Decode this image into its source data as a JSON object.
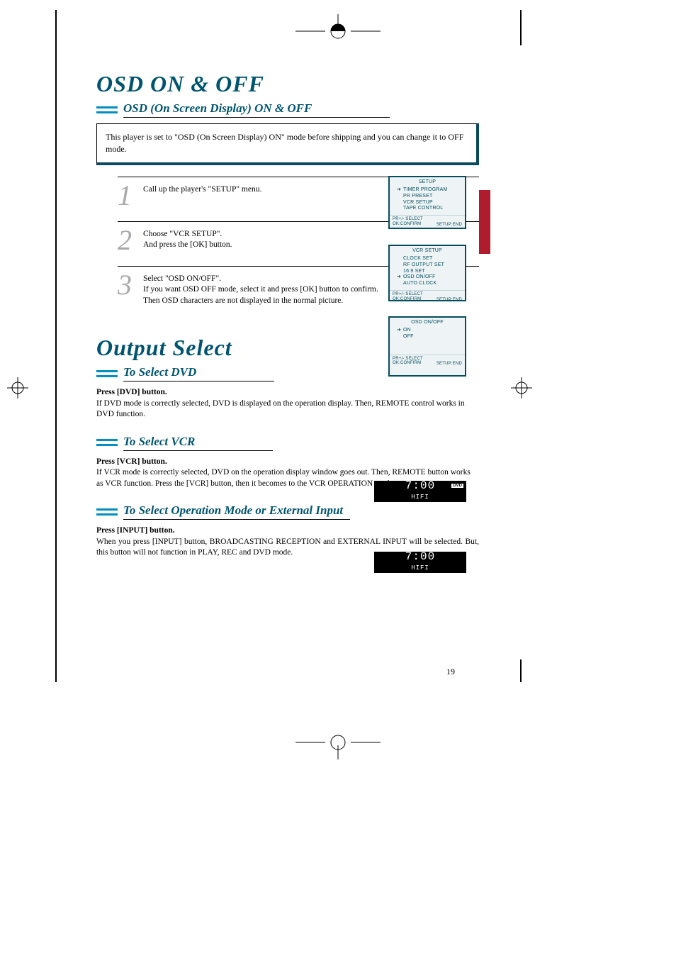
{
  "page_number": "19",
  "headings": {
    "main1": "OSD ON & OFF",
    "sub1": "OSD (On Screen Display) ON & OFF",
    "main2": "Output Select",
    "sub2": "To Select DVD",
    "sub3": "To Select VCR",
    "sub4": "To Select Operation Mode or External Input"
  },
  "intro": "This player is set to \"OSD (On Screen Display) ON\" mode before shipping and you can change it to OFF mode.",
  "steps": {
    "s1": {
      "num": "1",
      "text": "Call up the player's \"SETUP\" menu."
    },
    "s2": {
      "num": "2",
      "text": "Choose \"VCR SETUP\".\nAnd press the [OK] button."
    },
    "s3": {
      "num": "3",
      "text": "Select \"OSD ON/OFF\".\nIf you want OSD OFF mode, select it and press [OK] button to confirm.\nThen OSD characters are not displayed in the normal picture."
    }
  },
  "select_dvd": {
    "bold": "Press [DVD] button.",
    "body": "If DVD mode is correctly selected, DVD is displayed on the operation display. Then, REMOTE control works in DVD function."
  },
  "select_vcr": {
    "bold": "Press [VCR] button.",
    "body": "If VCR mode is correctly selected, DVD on the operation display window goes out. Then, REMOTE button works as VCR function. Press the [VCR] button, then it becomes to the VCR OPERATION mode."
  },
  "select_input": {
    "bold": "Press [INPUT] button.",
    "body": "When you press [INPUT] button, BROADCASTING RECEPTION and EXTERNAL INPUT will be selected. But, this button will not function in PLAY, REC and DVD mode."
  },
  "osd_panels": {
    "p1": {
      "title": "SETUP",
      "items": [
        "TIMER PROGRAM",
        "PR PRESET",
        "VCR SETUP",
        "TAPE CONTROL"
      ],
      "selected_index": 0,
      "footer_left1": "PR+/-:SELECT",
      "footer_left2": "OK:CONFIRM",
      "footer_right": "SETUP:END"
    },
    "p2": {
      "title": "VCR SETUP",
      "items": [
        "CLOCK SET",
        "RF OUTPUT SET",
        "16:9 SET",
        "OSD ON/OFF",
        "AUTO CLOCK"
      ],
      "selected_index": 3,
      "footer_left1": "PR+/-:SELECT",
      "footer_left2": "OK:CONFIRM",
      "footer_right": "SETUP:END"
    },
    "p3": {
      "title": "OSD ON/OFF",
      "items": [
        "ON",
        "OFF"
      ],
      "selected_index": 0,
      "footer_left1": "PR+/-:SELECT",
      "footer_left2": "OK:CONFIRM",
      "footer_right": "SETUP:END"
    }
  },
  "displays": {
    "time": "7:00",
    "sub": "HIFI",
    "dvd_label": "DVD"
  }
}
